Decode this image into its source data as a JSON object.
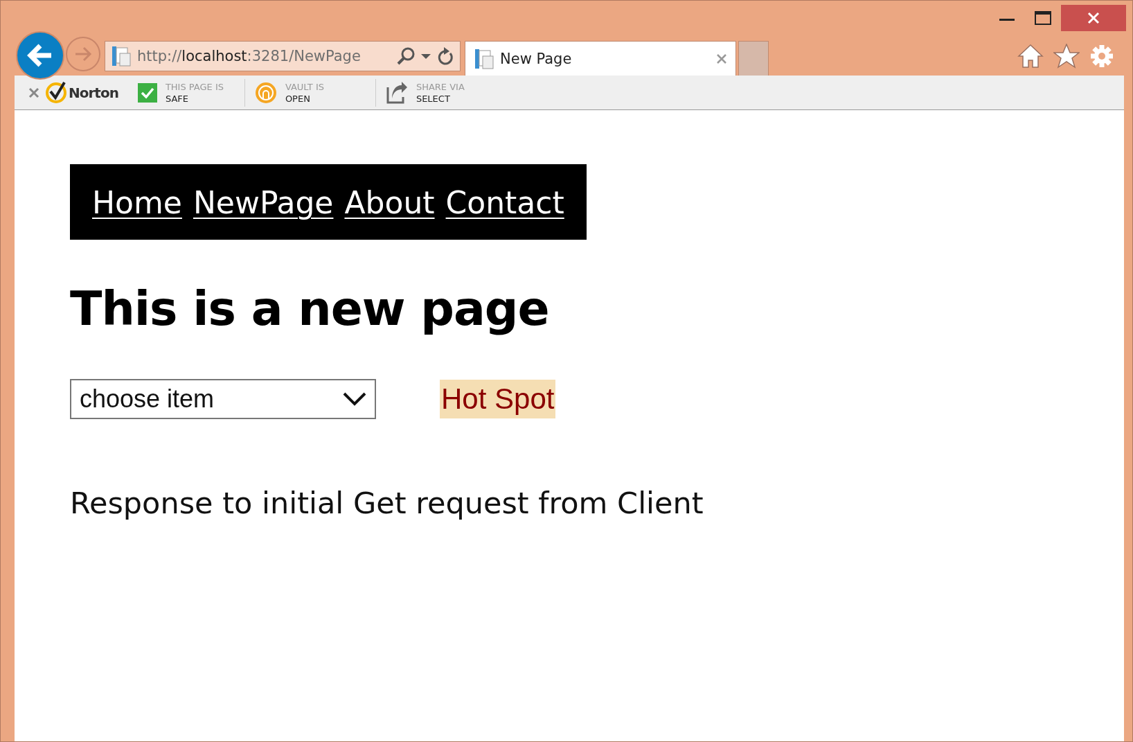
{
  "address_bar": {
    "prefix": "http://",
    "host": "localhost",
    "suffix": ":3281/NewPage"
  },
  "tabs": [
    {
      "label": "New Page",
      "selected": true
    }
  ],
  "norton_toolbar": {
    "brand": "Norton",
    "items": [
      {
        "kind": "check",
        "top": "THIS PAGE IS",
        "bottom": "SAFE"
      },
      {
        "kind": "vault",
        "top": "VAULT IS",
        "bottom": "OPEN"
      },
      {
        "kind": "share",
        "top": "SHARE VIA",
        "bottom": "SELECT"
      }
    ]
  },
  "page": {
    "nav": [
      "Home",
      "NewPage",
      "About",
      "Contact"
    ],
    "heading": "This is a new page",
    "dropdown": {
      "value": "choose item"
    },
    "hot_spot": "Hot Spot",
    "message": "Response to initial Get request from Client"
  }
}
